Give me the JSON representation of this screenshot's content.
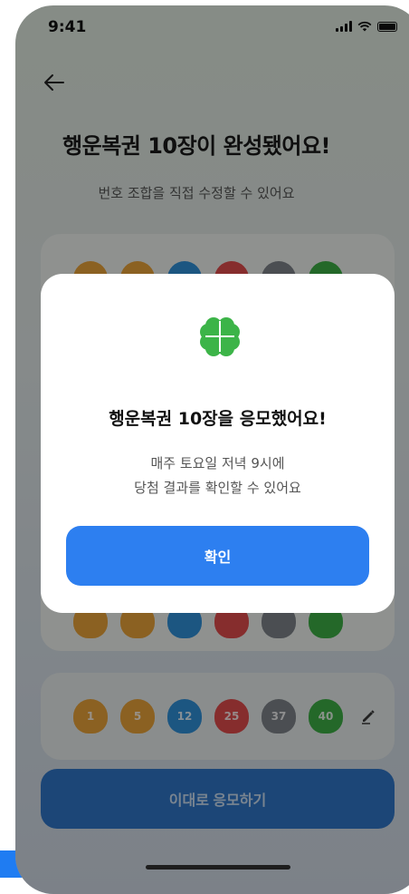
{
  "status_bar": {
    "time": "9:41"
  },
  "screen": {
    "title": "행운복권 10장이 완성됐어요!",
    "subtitle": "번호 조합을 직접 수정할 수 있어요",
    "submit_label": "이대로 응모하기"
  },
  "ticket_bottom": {
    "balls": [
      {
        "number": "1",
        "color": "#e8a23a"
      },
      {
        "number": "5",
        "color": "#e8a23a"
      },
      {
        "number": "12",
        "color": "#2f8fd8"
      },
      {
        "number": "25",
        "color": "#e04b4b"
      },
      {
        "number": "37",
        "color": "#7d8389"
      },
      {
        "number": "40",
        "color": "#3cae45"
      }
    ]
  },
  "ticket_top_colors": [
    "#e8a23a",
    "#e8a23a",
    "#2f8fd8",
    "#e04b4b",
    "#7d8389",
    "#3cae45"
  ],
  "modal": {
    "icon": "clover-icon",
    "title": "행운복권 10장을 응모했어요!",
    "desc_line1": "매주 토요일 저녁 9시에",
    "desc_line2": "당첨 결과를 확인할 수 있어요",
    "confirm_label": "확인"
  },
  "colors": {
    "accent": "#2d7ff0",
    "clover": "#3cb448"
  }
}
